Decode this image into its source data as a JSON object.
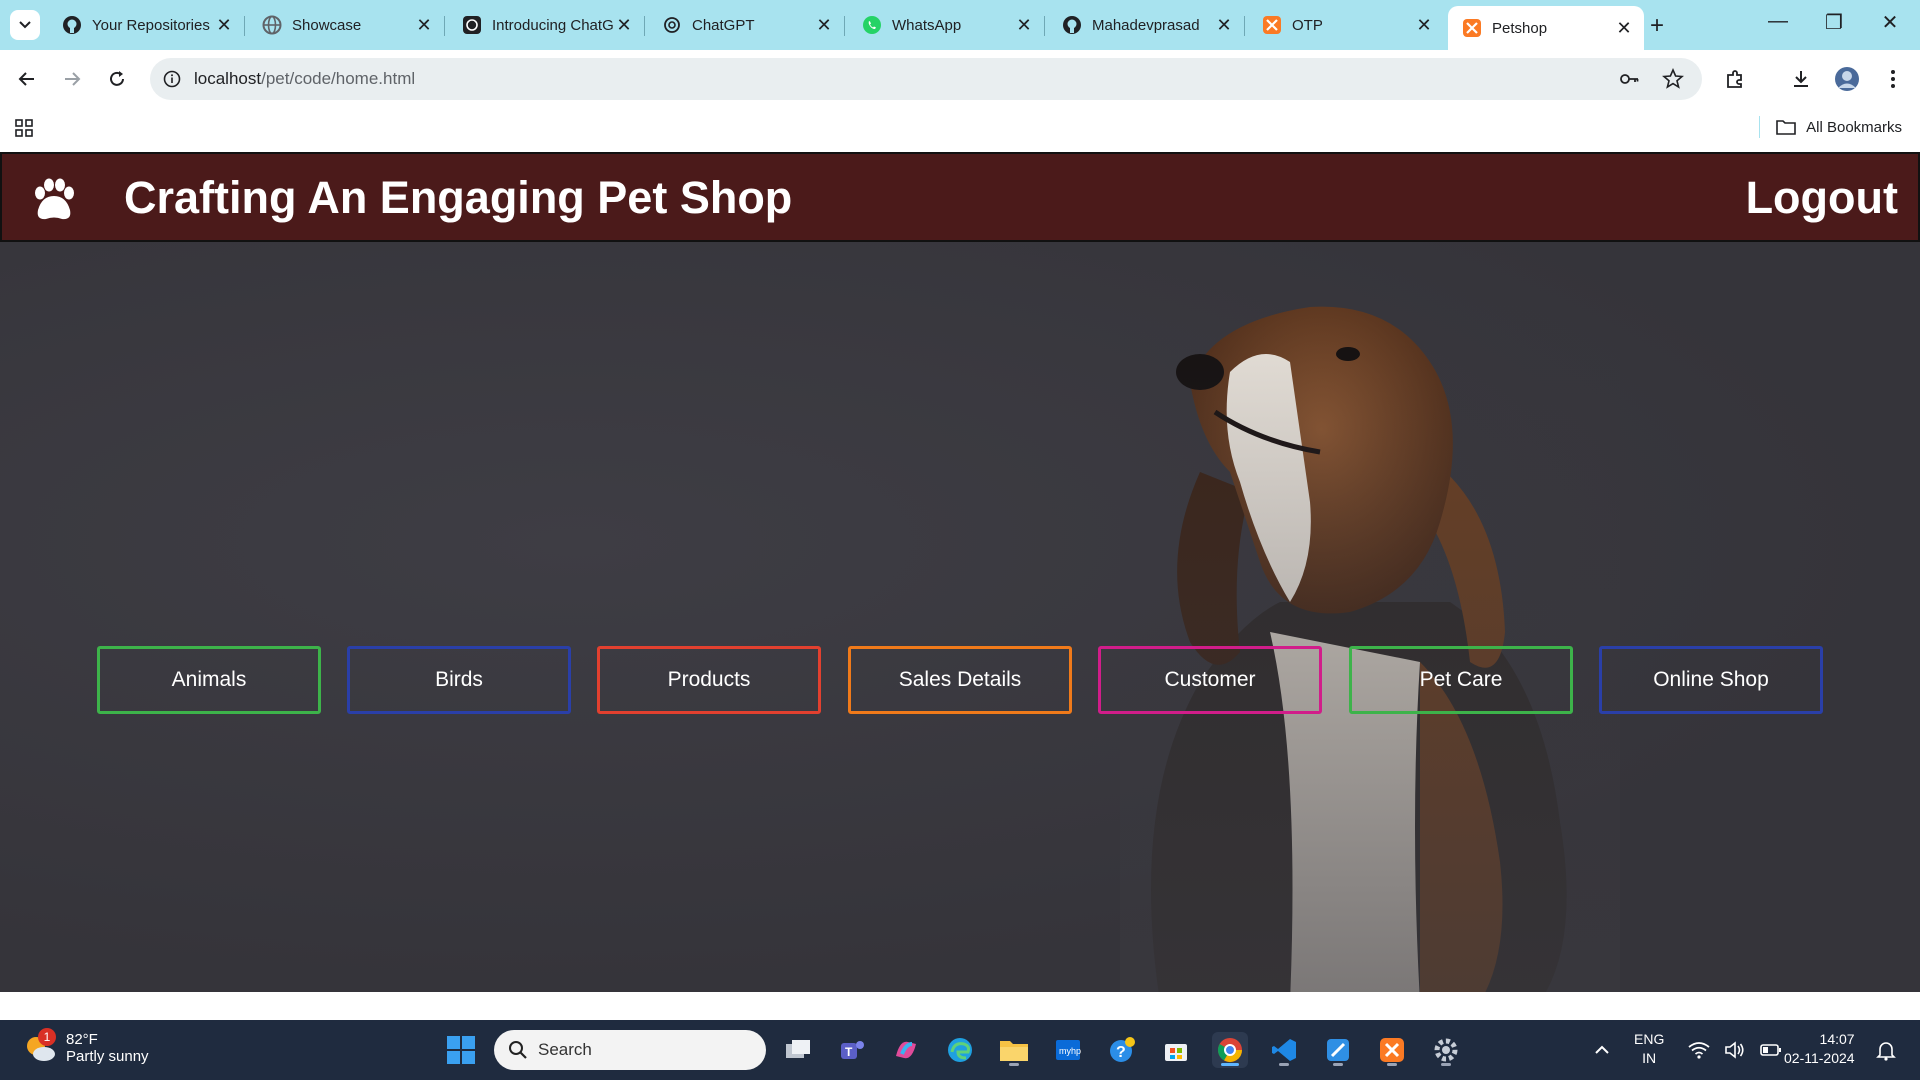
{
  "browser": {
    "tabs": [
      {
        "title": "Your Repositories",
        "icon": "github-icon"
      },
      {
        "title": "Showcase",
        "icon": "globe-icon"
      },
      {
        "title": "Introducing ChatGPT",
        "icon": "openai-icon"
      },
      {
        "title": "ChatGPT",
        "icon": "openai-icon"
      },
      {
        "title": "WhatsApp",
        "icon": "whatsapp-icon"
      },
      {
        "title": "Mahadevprasad",
        "icon": "github-icon"
      },
      {
        "title": "OTP",
        "icon": "xampp-icon"
      },
      {
        "title": "Petshop",
        "icon": "xampp-icon",
        "active": true
      }
    ],
    "url_host": "localhost",
    "url_path": "/pet/code/home.html",
    "all_bookmarks": "All Bookmarks"
  },
  "site": {
    "title": "Crafting An Engaging Pet Shop",
    "logout_label": "Logout",
    "header_color": "#4b1a1a",
    "menu": [
      {
        "label": "Animals",
        "color": "#3db34a"
      },
      {
        "label": "Birds",
        "color": "#2a3fa8"
      },
      {
        "label": "Products",
        "color": "#e2402f"
      },
      {
        "label": "Sales Details",
        "color": "#f07a1a"
      },
      {
        "label": "Customer",
        "color": "#d11d8a"
      },
      {
        "label": "Pet Care",
        "color": "#3db34a"
      },
      {
        "label": "Online Shop",
        "color": "#2a3fa8"
      }
    ]
  },
  "taskbar": {
    "weather_temp": "82°F",
    "weather_desc": "Partly sunny",
    "weather_badge": "1",
    "search_placeholder": "Search",
    "lang_line1": "ENG",
    "lang_line2": "IN",
    "time": "14:07",
    "date": "02-11-2024"
  }
}
